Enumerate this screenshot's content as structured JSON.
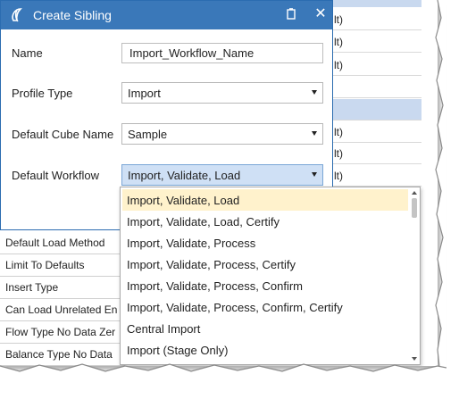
{
  "dialog": {
    "title": "Create Sibling",
    "icons": {
      "logo": "app-logo-icon",
      "pin": "pin-icon",
      "close": "close-icon"
    },
    "close_glyph": "✕",
    "fields": {
      "name": {
        "label": "Name",
        "value": "Import_Workflow_Name"
      },
      "profile_type": {
        "label": "Profile Type",
        "value": "Import"
      },
      "default_cube_name": {
        "label": "Default Cube Name",
        "value": "Sample"
      },
      "default_workflow": {
        "label": "Default Workflow",
        "value": "Import, Validate, Load"
      }
    },
    "dropdown_options": [
      "Import, Validate, Load",
      "Import, Validate, Load, Certify",
      "Import, Validate, Process",
      "Import, Validate, Process, Certify",
      "Import, Validate, Process, Confirm",
      "Import, Validate, Process, Confirm, Certify",
      "Central Import",
      "Import  (Stage Only)"
    ],
    "highlighted_option_index": 0
  },
  "background": {
    "grid_cells": [
      "lt)",
      "lt)",
      "lt)",
      "",
      "",
      "lt)",
      "lt)",
      "lt)"
    ],
    "properties": [
      "Default Load Method",
      "Limit To Defaults",
      "Insert Type",
      "Can Load Unrelated En",
      "Flow Type No Data Zer",
      "Balance Type No Data"
    ]
  },
  "colors": {
    "titlebar": "#3a78b9",
    "selection_blue": "#c9d9ef",
    "highlight_yellow": "#fff2cc"
  }
}
